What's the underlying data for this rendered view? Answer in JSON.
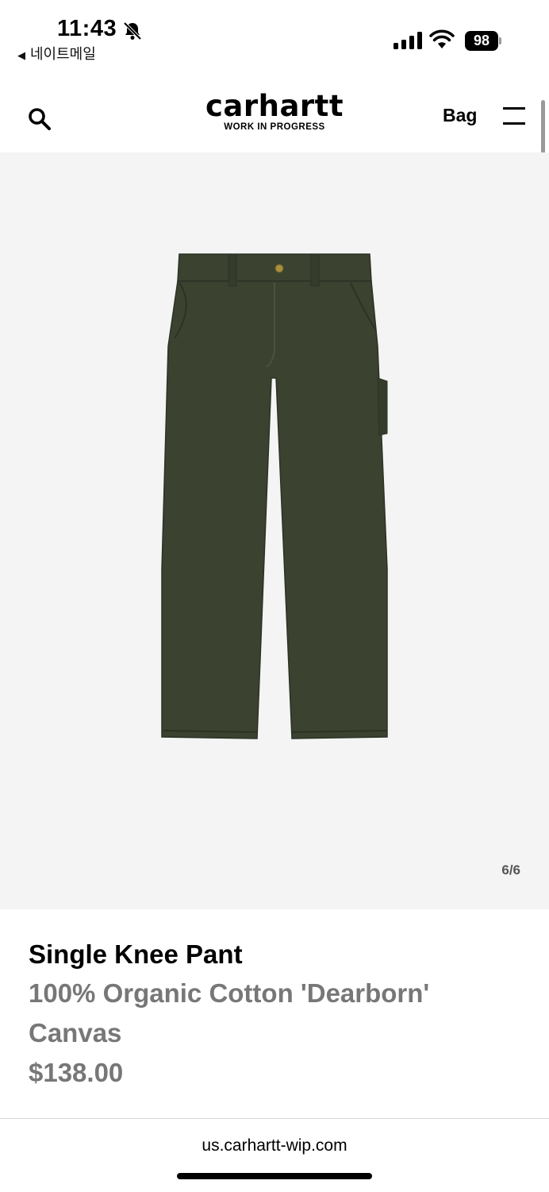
{
  "status_bar": {
    "time": "11:43",
    "back_app": "네이트메일",
    "battery": "98",
    "icons": [
      "bell-off-icon",
      "signal-icon",
      "wifi-icon",
      "battery-icon"
    ]
  },
  "header": {
    "logo_word": "carhartt",
    "logo_sub": "WORK IN PROGRESS",
    "bag_label": "Bag",
    "icons": [
      "search-icon",
      "menu-icon"
    ]
  },
  "gallery": {
    "counter": "6/6",
    "image": "pant-image",
    "pant_color": "#3b4230"
  },
  "product": {
    "name": "Single Knee Pant",
    "material": "100% Organic Cotton 'Dearborn' Canvas",
    "price": "$138.00"
  },
  "browser": {
    "url": "us.carhartt-wip.com"
  }
}
